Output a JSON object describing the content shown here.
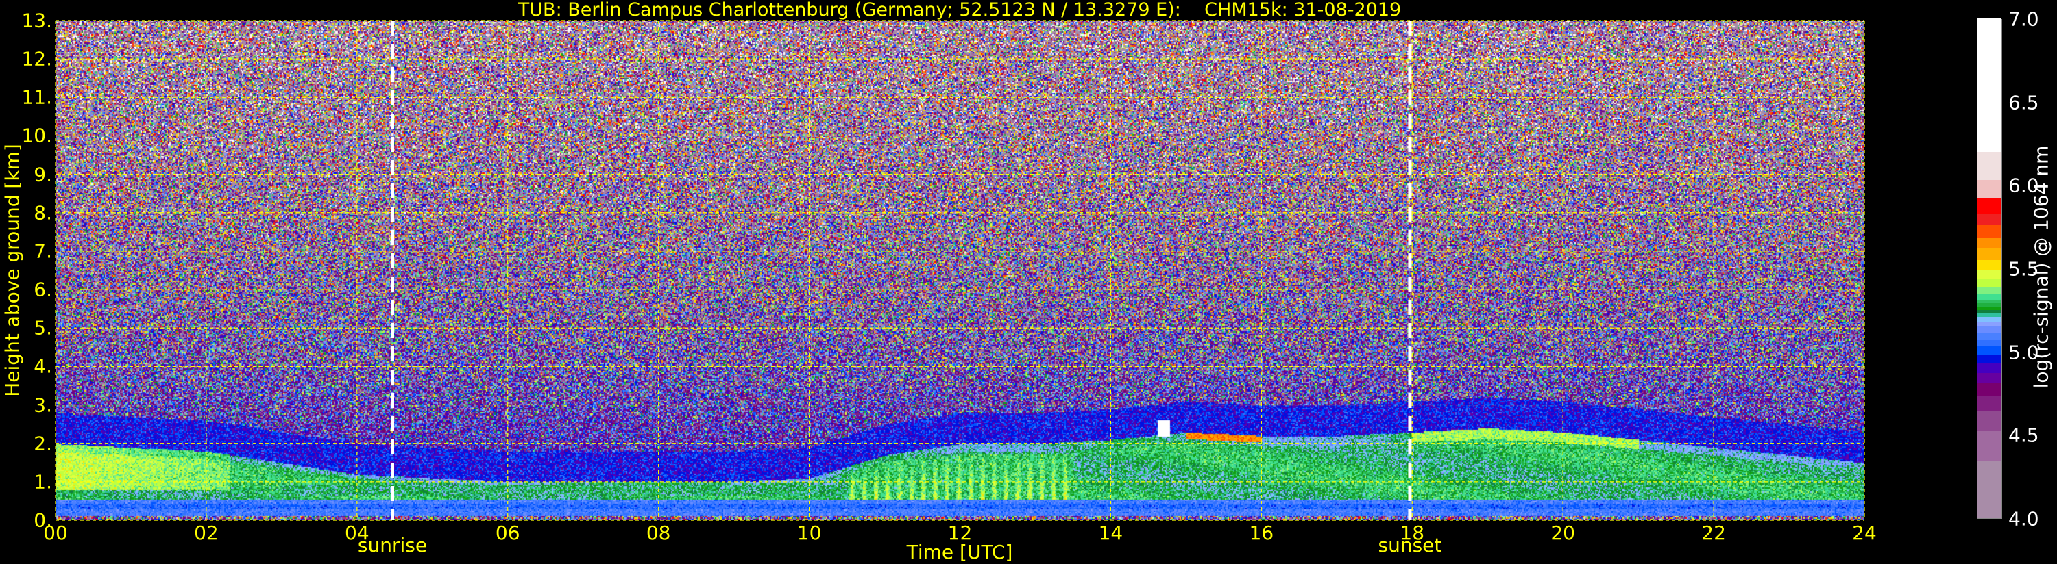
{
  "title": "TUB: Berlin Campus Charlottenburg (Germany; 52.5123 N / 13.3279 E):    CHM15k: 31-08-2019",
  "chart_data": {
    "type": "heatmap",
    "title": "TUB: Berlin Campus Charlottenburg (Germany; 52.5123 N / 13.3279 E):    CHM15k: 31-08-2019",
    "xlabel": "Time [UTC]",
    "ylabel": "Height above ground [km]",
    "xlim": [
      0,
      24
    ],
    "ylim": [
      0,
      13
    ],
    "x_ticks": [
      "00",
      "02",
      "04",
      "06",
      "08",
      "10",
      "12",
      "14",
      "16",
      "18",
      "20",
      "22",
      "24"
    ],
    "y_ticks": [
      "0.",
      "1.",
      "2.",
      "3.",
      "4.",
      "5.",
      "6.",
      "7.",
      "8.",
      "9.",
      "10.",
      "11.",
      "12.",
      "13."
    ],
    "grid": true,
    "grid_color": "#ffff00",
    "events": [
      {
        "label": "sunrise",
        "time_h": 4.47
      },
      {
        "label": "sunset",
        "time_h": 17.97
      }
    ],
    "colorbar": {
      "label": "log(rc-signal) @ 1064 nm",
      "range": [
        4.0,
        7.0
      ],
      "ticks": [
        "4.0",
        "4.5",
        "5.0",
        "5.5",
        "6.0",
        "6.5",
        "7.0"
      ],
      "levels": [
        [
          4.0,
          "#a88ca8"
        ],
        [
          4.34,
          "#a06aa0"
        ],
        [
          4.52,
          "#904a90"
        ],
        [
          4.64,
          "#802080"
        ],
        [
          4.73,
          "#78006e"
        ],
        [
          4.81,
          "#6600a0"
        ],
        [
          4.87,
          "#4400c0"
        ],
        [
          4.93,
          "#0010e0"
        ],
        [
          4.98,
          "#0055ff"
        ],
        [
          5.03,
          "#3070ff"
        ],
        [
          5.07,
          "#4a80ff"
        ],
        [
          5.11,
          "#6a8cff"
        ],
        [
          5.15,
          "#8aa0ff"
        ],
        [
          5.18,
          "#80c0ff"
        ],
        [
          5.21,
          "#30c0a0"
        ],
        [
          5.23,
          "#108040"
        ],
        [
          5.25,
          "#10a010"
        ],
        [
          5.27,
          "#20b040"
        ],
        [
          5.29,
          "#30c060"
        ],
        [
          5.31,
          "#40e090"
        ],
        [
          5.35,
          "#80f080"
        ],
        [
          5.39,
          "#c0ff40"
        ],
        [
          5.44,
          "#e0ff40"
        ],
        [
          5.49,
          "#ffe000"
        ],
        [
          5.55,
          "#ffb000"
        ],
        [
          5.62,
          "#ff9000"
        ],
        [
          5.68,
          "#ff5000"
        ],
        [
          5.76,
          "#f02020"
        ],
        [
          5.83,
          "#ff0000"
        ],
        [
          5.92,
          "#f0c0c0"
        ],
        [
          6.03,
          "#f0e0e0"
        ],
        [
          6.2,
          "#ffffff"
        ]
      ]
    },
    "aerosol_layer_top_km": {
      "time_h": [
        0,
        1,
        2,
        3,
        4,
        5,
        6,
        7,
        8,
        9,
        10,
        11,
        12,
        13,
        14,
        15,
        16,
        17,
        18,
        19,
        20,
        21,
        22,
        23,
        24
      ],
      "height": [
        2.0,
        1.9,
        1.8,
        1.5,
        1.2,
        1.1,
        1.0,
        1.0,
        1.0,
        1.0,
        1.1,
        1.7,
        2.0,
        2.0,
        2.1,
        2.3,
        2.2,
        2.2,
        2.3,
        2.4,
        2.3,
        2.1,
        1.9,
        1.7,
        1.5
      ]
    },
    "cloud": {
      "time_h": 14.7,
      "height_km": 2.4
    }
  }
}
